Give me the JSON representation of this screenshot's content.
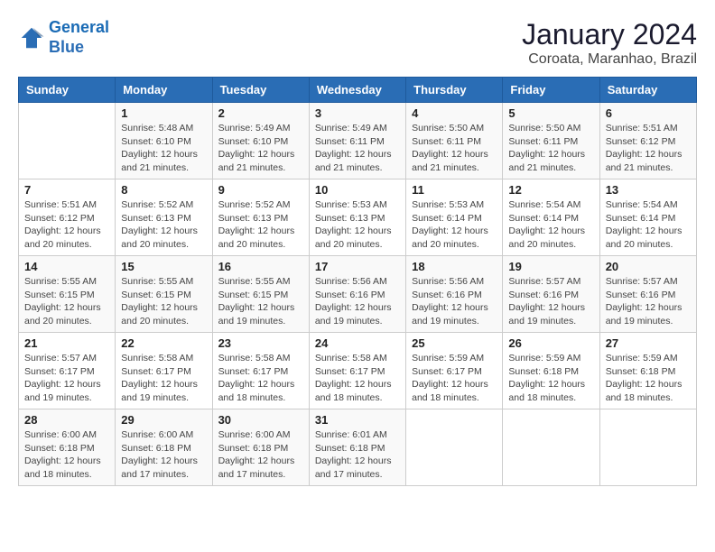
{
  "logo": {
    "line1": "General",
    "line2": "Blue"
  },
  "title": "January 2024",
  "location": "Coroata, Maranhao, Brazil",
  "weekdays": [
    "Sunday",
    "Monday",
    "Tuesday",
    "Wednesday",
    "Thursday",
    "Friday",
    "Saturday"
  ],
  "weeks": [
    [
      {
        "day": "",
        "info": ""
      },
      {
        "day": "1",
        "info": "Sunrise: 5:48 AM\nSunset: 6:10 PM\nDaylight: 12 hours\nand 21 minutes."
      },
      {
        "day": "2",
        "info": "Sunrise: 5:49 AM\nSunset: 6:10 PM\nDaylight: 12 hours\nand 21 minutes."
      },
      {
        "day": "3",
        "info": "Sunrise: 5:49 AM\nSunset: 6:11 PM\nDaylight: 12 hours\nand 21 minutes."
      },
      {
        "day": "4",
        "info": "Sunrise: 5:50 AM\nSunset: 6:11 PM\nDaylight: 12 hours\nand 21 minutes."
      },
      {
        "day": "5",
        "info": "Sunrise: 5:50 AM\nSunset: 6:11 PM\nDaylight: 12 hours\nand 21 minutes."
      },
      {
        "day": "6",
        "info": "Sunrise: 5:51 AM\nSunset: 6:12 PM\nDaylight: 12 hours\nand 21 minutes."
      }
    ],
    [
      {
        "day": "7",
        "info": "Sunrise: 5:51 AM\nSunset: 6:12 PM\nDaylight: 12 hours\nand 20 minutes."
      },
      {
        "day": "8",
        "info": "Sunrise: 5:52 AM\nSunset: 6:13 PM\nDaylight: 12 hours\nand 20 minutes."
      },
      {
        "day": "9",
        "info": "Sunrise: 5:52 AM\nSunset: 6:13 PM\nDaylight: 12 hours\nand 20 minutes."
      },
      {
        "day": "10",
        "info": "Sunrise: 5:53 AM\nSunset: 6:13 PM\nDaylight: 12 hours\nand 20 minutes."
      },
      {
        "day": "11",
        "info": "Sunrise: 5:53 AM\nSunset: 6:14 PM\nDaylight: 12 hours\nand 20 minutes."
      },
      {
        "day": "12",
        "info": "Sunrise: 5:54 AM\nSunset: 6:14 PM\nDaylight: 12 hours\nand 20 minutes."
      },
      {
        "day": "13",
        "info": "Sunrise: 5:54 AM\nSunset: 6:14 PM\nDaylight: 12 hours\nand 20 minutes."
      }
    ],
    [
      {
        "day": "14",
        "info": "Sunrise: 5:55 AM\nSunset: 6:15 PM\nDaylight: 12 hours\nand 20 minutes."
      },
      {
        "day": "15",
        "info": "Sunrise: 5:55 AM\nSunset: 6:15 PM\nDaylight: 12 hours\nand 20 minutes."
      },
      {
        "day": "16",
        "info": "Sunrise: 5:55 AM\nSunset: 6:15 PM\nDaylight: 12 hours\nand 19 minutes."
      },
      {
        "day": "17",
        "info": "Sunrise: 5:56 AM\nSunset: 6:16 PM\nDaylight: 12 hours\nand 19 minutes."
      },
      {
        "day": "18",
        "info": "Sunrise: 5:56 AM\nSunset: 6:16 PM\nDaylight: 12 hours\nand 19 minutes."
      },
      {
        "day": "19",
        "info": "Sunrise: 5:57 AM\nSunset: 6:16 PM\nDaylight: 12 hours\nand 19 minutes."
      },
      {
        "day": "20",
        "info": "Sunrise: 5:57 AM\nSunset: 6:16 PM\nDaylight: 12 hours\nand 19 minutes."
      }
    ],
    [
      {
        "day": "21",
        "info": "Sunrise: 5:57 AM\nSunset: 6:17 PM\nDaylight: 12 hours\nand 19 minutes."
      },
      {
        "day": "22",
        "info": "Sunrise: 5:58 AM\nSunset: 6:17 PM\nDaylight: 12 hours\nand 19 minutes."
      },
      {
        "day": "23",
        "info": "Sunrise: 5:58 AM\nSunset: 6:17 PM\nDaylight: 12 hours\nand 18 minutes."
      },
      {
        "day": "24",
        "info": "Sunrise: 5:58 AM\nSunset: 6:17 PM\nDaylight: 12 hours\nand 18 minutes."
      },
      {
        "day": "25",
        "info": "Sunrise: 5:59 AM\nSunset: 6:17 PM\nDaylight: 12 hours\nand 18 minutes."
      },
      {
        "day": "26",
        "info": "Sunrise: 5:59 AM\nSunset: 6:18 PM\nDaylight: 12 hours\nand 18 minutes."
      },
      {
        "day": "27",
        "info": "Sunrise: 5:59 AM\nSunset: 6:18 PM\nDaylight: 12 hours\nand 18 minutes."
      }
    ],
    [
      {
        "day": "28",
        "info": "Sunrise: 6:00 AM\nSunset: 6:18 PM\nDaylight: 12 hours\nand 18 minutes."
      },
      {
        "day": "29",
        "info": "Sunrise: 6:00 AM\nSunset: 6:18 PM\nDaylight: 12 hours\nand 17 minutes."
      },
      {
        "day": "30",
        "info": "Sunrise: 6:00 AM\nSunset: 6:18 PM\nDaylight: 12 hours\nand 17 minutes."
      },
      {
        "day": "31",
        "info": "Sunrise: 6:01 AM\nSunset: 6:18 PM\nDaylight: 12 hours\nand 17 minutes."
      },
      {
        "day": "",
        "info": ""
      },
      {
        "day": "",
        "info": ""
      },
      {
        "day": "",
        "info": ""
      }
    ]
  ]
}
